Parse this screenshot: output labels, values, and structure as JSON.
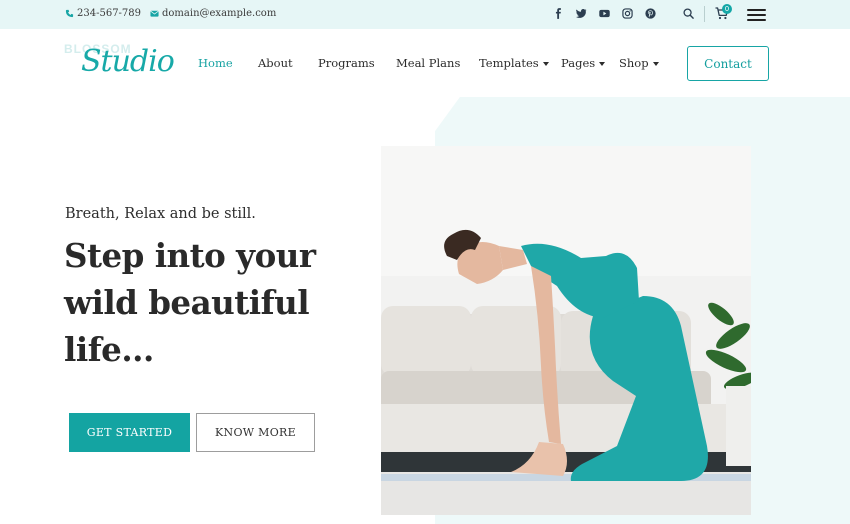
{
  "topbar": {
    "phone": "234-567-789",
    "email": "domain@example.com",
    "socials": [
      "facebook-icon",
      "twitter-icon",
      "youtube-icon",
      "instagram-icon",
      "pinterest-icon"
    ],
    "cart_count": "0"
  },
  "logo": {
    "small_text": "BLOSSOM",
    "script_text": "Studio"
  },
  "nav": {
    "items": [
      {
        "label": "Home",
        "active": true,
        "has_dropdown": false
      },
      {
        "label": "About",
        "active": false,
        "has_dropdown": false
      },
      {
        "label": "Programs",
        "active": false,
        "has_dropdown": false
      },
      {
        "label": "Meal Plans",
        "active": false,
        "has_dropdown": false
      },
      {
        "label": "Templates",
        "active": false,
        "has_dropdown": true
      },
      {
        "label": "Pages",
        "active": false,
        "has_dropdown": true
      },
      {
        "label": "Shop",
        "active": false,
        "has_dropdown": true
      }
    ],
    "contact_label": "Contact"
  },
  "hero": {
    "tagline": "Breath, Relax and be still.",
    "headline_line1": "Step into your",
    "headline_line2": "wild beautiful",
    "headline_line3": "life...",
    "primary_button": "GET STARTED",
    "secondary_button": "KNOW MORE"
  },
  "colors": {
    "accent": "#14a4a2",
    "topbar_bg": "#e6f6f6",
    "hero_bg": "#eef9f9",
    "text": "#2a2a2a"
  }
}
